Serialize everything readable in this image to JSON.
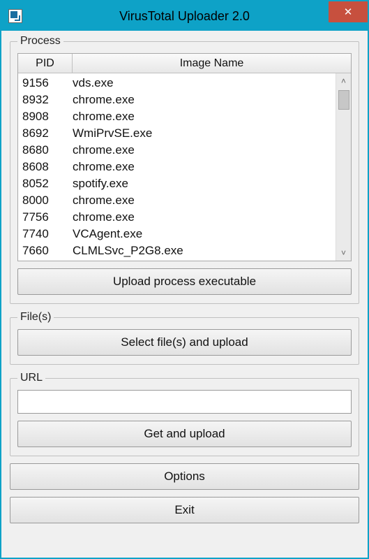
{
  "window": {
    "title": "VirusTotal Uploader 2.0"
  },
  "process_section": {
    "legend": "Process",
    "columns": {
      "pid": "PID",
      "image": "Image Name"
    },
    "rows": [
      {
        "pid": "9156",
        "name": "vds.exe"
      },
      {
        "pid": "8932",
        "name": "chrome.exe"
      },
      {
        "pid": "8908",
        "name": "chrome.exe"
      },
      {
        "pid": "8692",
        "name": "WmiPrvSE.exe"
      },
      {
        "pid": "8680",
        "name": "chrome.exe"
      },
      {
        "pid": "8608",
        "name": "chrome.exe"
      },
      {
        "pid": "8052",
        "name": "spotify.exe"
      },
      {
        "pid": "8000",
        "name": "chrome.exe"
      },
      {
        "pid": "7756",
        "name": "chrome.exe"
      },
      {
        "pid": "7740",
        "name": "VCAgent.exe"
      },
      {
        "pid": "7660",
        "name": "CLMLSvc_P2G8.exe"
      }
    ],
    "upload_button": "Upload process executable"
  },
  "files_section": {
    "legend": "File(s)",
    "select_button": "Select file(s) and upload"
  },
  "url_section": {
    "legend": "URL",
    "value": "",
    "get_button": "Get and upload"
  },
  "buttons": {
    "options": "Options",
    "exit": "Exit"
  }
}
